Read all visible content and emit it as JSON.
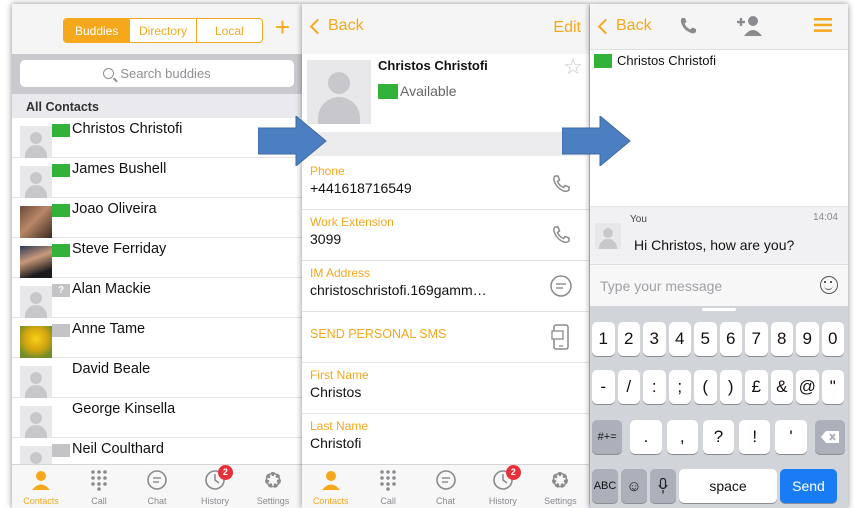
{
  "contacts_panel": {
    "segments": [
      "Buddies",
      "Directory",
      "Local"
    ],
    "add_icon": "plus-icon",
    "search_placeholder": "Search buddies",
    "section_header": "All Contacts",
    "contacts": [
      {
        "name": "Christos Christofi",
        "presence": "available",
        "avatar": "placeholder"
      },
      {
        "name": "James Bushell",
        "presence": "available",
        "avatar": "placeholder"
      },
      {
        "name": "Joao Oliveira",
        "presence": "available",
        "avatar": "photo"
      },
      {
        "name": "Steve Ferriday",
        "presence": "available",
        "avatar": "photo"
      },
      {
        "name": "Alan Mackie",
        "presence": "unknown",
        "avatar": "placeholder"
      },
      {
        "name": "Anne Tame",
        "presence": "offline",
        "avatar": "photo"
      },
      {
        "name": "David Beale",
        "presence": "none",
        "avatar": "placeholder"
      },
      {
        "name": "George Kinsella",
        "presence": "none",
        "avatar": "placeholder"
      },
      {
        "name": "Neil Coulthard",
        "presence": "offline",
        "avatar": "placeholder"
      }
    ]
  },
  "tabbar": {
    "tabs": [
      {
        "label": "Contacts",
        "icon": "person-icon",
        "active": true
      },
      {
        "label": "Call",
        "icon": "keypad-icon"
      },
      {
        "label": "Chat",
        "icon": "chat-bubble-icon"
      },
      {
        "label": "History",
        "icon": "clock-icon",
        "badge": "2"
      },
      {
        "label": "Settings",
        "icon": "gear-icon"
      }
    ]
  },
  "details_panel": {
    "back_label": "Back",
    "edit_label": "Edit",
    "name": "Christos Christofi",
    "status": "Available",
    "fields": [
      {
        "label": "Phone",
        "value": "+441618716549",
        "action_icon": "phone-icon"
      },
      {
        "label": "Work Extension",
        "value": "3099",
        "action_icon": "phone-icon"
      },
      {
        "label": "IM Address",
        "value": "christoschristofi.169gamm…",
        "action_icon": "chat-bubble-icon"
      },
      {
        "label": "SEND PERSONAL SMS",
        "value": "",
        "action_icon": "mobile-sms-icon"
      },
      {
        "label": "First Name",
        "value": "Christos"
      },
      {
        "label": "Last Name",
        "value": "Christofi"
      }
    ]
  },
  "chat_panel": {
    "back_label": "Back",
    "contact_name": "Christos Christofi",
    "message": {
      "sender": "You",
      "time": "14:04",
      "text": "Hi Christos, how are you?"
    },
    "input_placeholder": "Type your message",
    "keyboard": {
      "row1": [
        "1",
        "2",
        "3",
        "4",
        "5",
        "6",
        "7",
        "8",
        "9",
        "0"
      ],
      "row2": [
        "-",
        "/",
        ":",
        ";",
        "(",
        ")",
        "£",
        "&",
        "@",
        "\""
      ],
      "row3": [
        ".",
        ",",
        "?",
        "!",
        "'"
      ],
      "shift_label": "#+=",
      "abc_label": "ABC",
      "space_label": "space",
      "send_label": "Send"
    }
  },
  "colors": {
    "accent": "#f6a81d",
    "available": "#33b23a",
    "badge": "#e8303a",
    "send": "#1a7cf4",
    "arrow": "#4a7fc1"
  }
}
